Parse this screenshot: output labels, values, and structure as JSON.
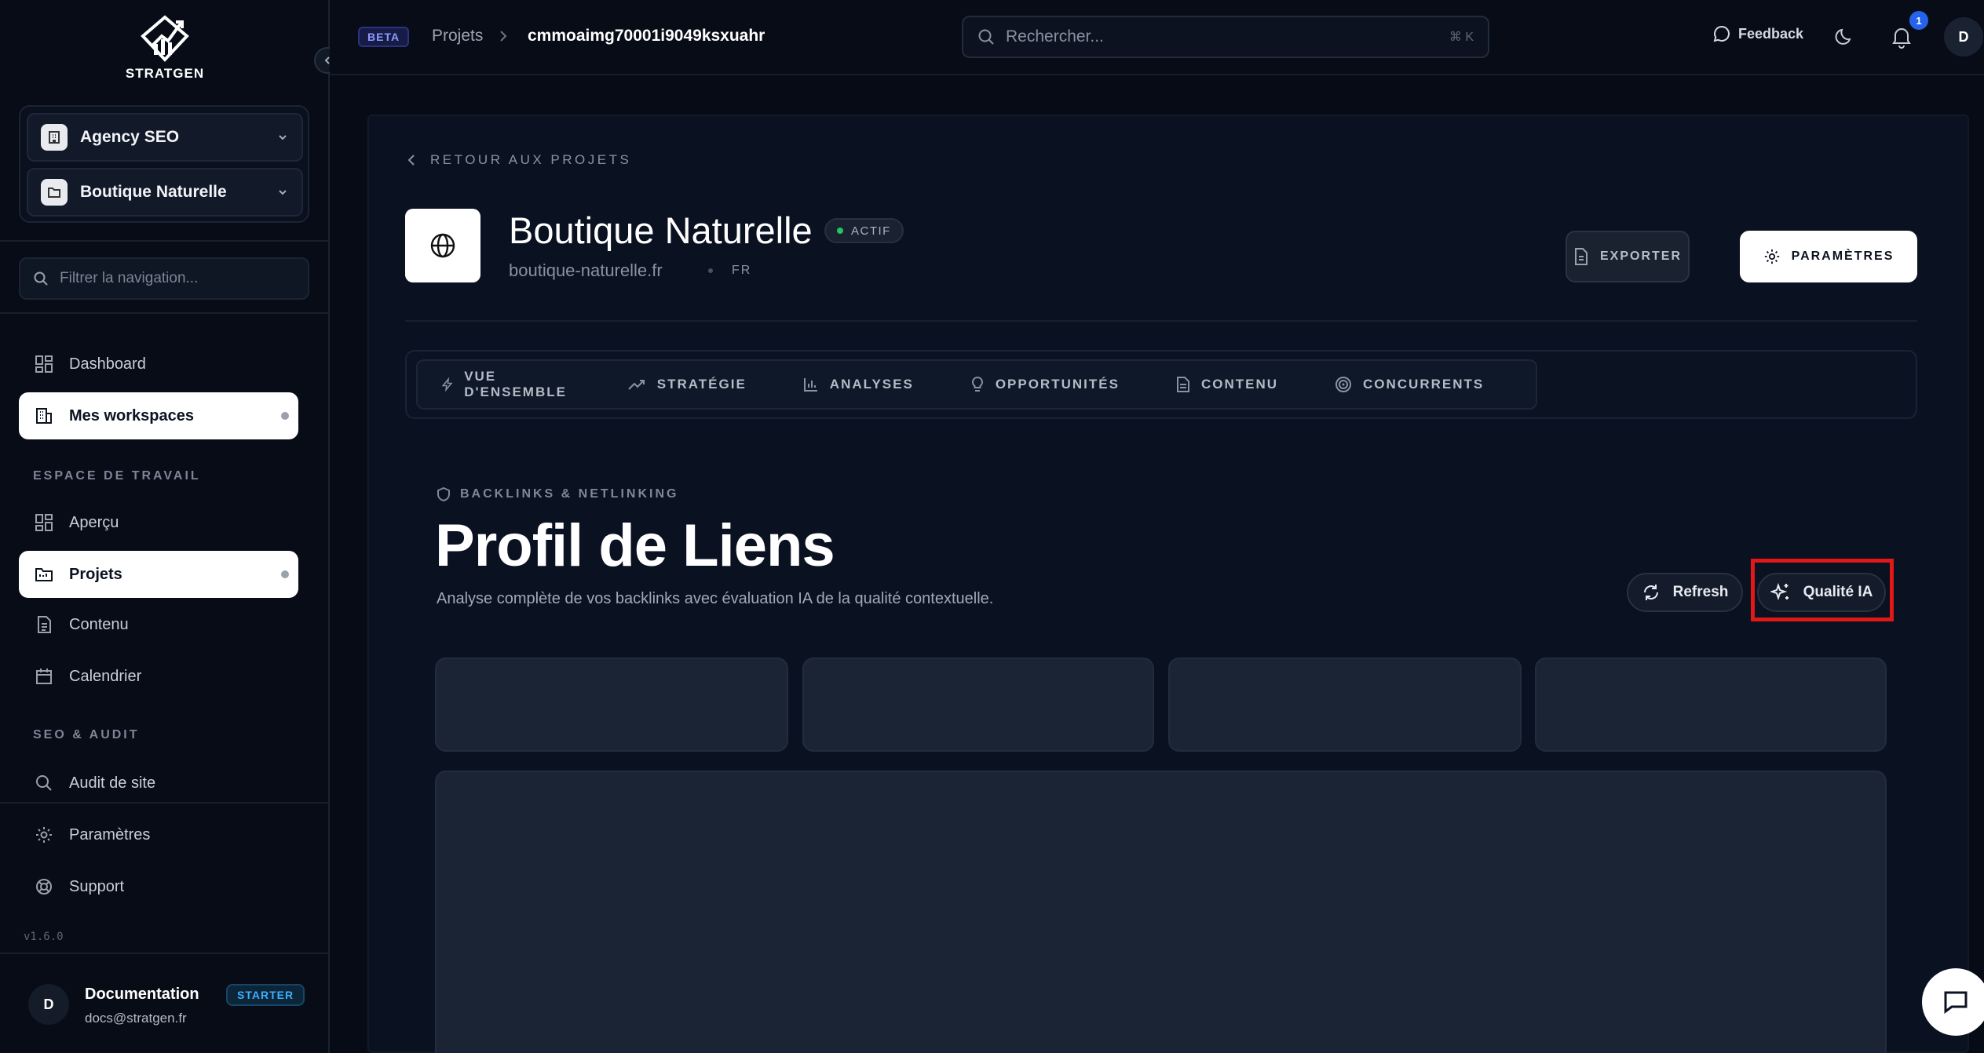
{
  "app": {
    "logo_text": "STRATGEN",
    "version": "v1.6.0"
  },
  "sidebar": {
    "workspace": "Agency SEO",
    "project": "Boutique Naturelle",
    "filter_placeholder": "Filtrer la navigation...",
    "top_items": [
      {
        "label": "Dashboard",
        "icon": "dashboard-icon",
        "active": false
      },
      {
        "label": "Mes workspaces",
        "icon": "building-icon",
        "active": true
      }
    ],
    "section_workspace": "ESPACE DE TRAVAIL",
    "workspace_items": [
      {
        "label": "Aperçu",
        "icon": "grid-icon",
        "active": false
      },
      {
        "label": "Projets",
        "icon": "folder-icon",
        "active": true
      },
      {
        "label": "Contenu",
        "icon": "document-icon",
        "active": false
      },
      {
        "label": "Calendrier",
        "icon": "calendar-icon",
        "active": false
      }
    ],
    "section_seo": "SEO & AUDIT",
    "seo_items": [
      {
        "label": "Audit de site",
        "icon": "search-icon"
      }
    ],
    "bottom_items": [
      {
        "label": "Paramètres",
        "icon": "gear-icon"
      },
      {
        "label": "Support",
        "icon": "lifebuoy-icon"
      }
    ],
    "user": {
      "initial": "D",
      "name": "Documentation",
      "email": "docs@stratgen.fr",
      "plan": "STARTER"
    }
  },
  "topbar": {
    "beta": "BETA",
    "breadcrumb": [
      "Projets",
      "cmmoaimg70001i9049ksxuahr"
    ],
    "search_placeholder": "Rechercher...",
    "search_shortcut": "⌘ K",
    "feedback": "Feedback",
    "notifications": "1",
    "avatar": "D"
  },
  "project": {
    "back": "RETOUR AUX PROJETS",
    "name": "Boutique Naturelle",
    "status": "ACTIF",
    "domain": "boutique-naturelle.fr",
    "lang": "FR",
    "export": "EXPORTER",
    "settings": "PARAMÈTRES"
  },
  "tabs": [
    {
      "label": "VUE D'ENSEMBLE",
      "icon": "bolt-icon"
    },
    {
      "label": "STRATÉGIE",
      "icon": "trend-icon"
    },
    {
      "label": "ANALYSES",
      "icon": "bar-chart-icon"
    },
    {
      "label": "OPPORTUNITÉS",
      "icon": "bulb-icon"
    },
    {
      "label": "CONTENU",
      "icon": "document-icon"
    },
    {
      "label": "CONCURRENTS",
      "icon": "target-icon"
    }
  ],
  "section": {
    "eyebrow": "BACKLINKS & NETLINKING",
    "title": "Profil de Liens",
    "subtitle": "Analyse complète de vos backlinks avec évaluation IA de la qualité contextuelle.",
    "refresh": "Refresh",
    "ai_quality": "Qualité IA"
  },
  "colors": {
    "background": "#060b16",
    "accent_status": "#22c55e",
    "highlight": "#e01818",
    "notification": "#2563eb"
  }
}
